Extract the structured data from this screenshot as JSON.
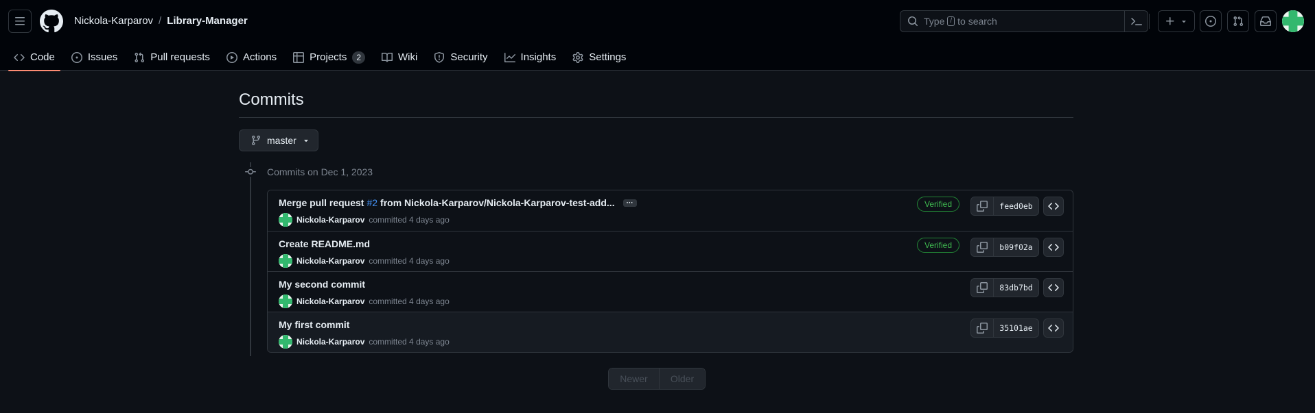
{
  "repo": {
    "owner": "Nickola-Karparov",
    "separator": "/",
    "name": "Library-Manager"
  },
  "search": {
    "placeholder_before": "Type",
    "slash": "/",
    "placeholder_after": "to search"
  },
  "header_icons": [
    "hamburger-icon",
    "github-logo",
    "command-palette-icon",
    "plus-icon",
    "issue-opened-icon",
    "pull-request-icon",
    "inbox-icon"
  ],
  "tabs": [
    {
      "label": "Code",
      "icon": "code-icon",
      "active": true
    },
    {
      "label": "Issues",
      "icon": "issue-icon"
    },
    {
      "label": "Pull requests",
      "icon": "pull-request-icon"
    },
    {
      "label": "Actions",
      "icon": "play-icon"
    },
    {
      "label": "Projects",
      "icon": "table-icon",
      "counter": "2"
    },
    {
      "label": "Wiki",
      "icon": "book-icon"
    },
    {
      "label": "Security",
      "icon": "shield-icon"
    },
    {
      "label": "Insights",
      "icon": "graph-icon"
    },
    {
      "label": "Settings",
      "icon": "gear-icon"
    }
  ],
  "page": {
    "title": "Commits",
    "branch": "master"
  },
  "commit_group": {
    "date_label": "Commits on Dec 1, 2023"
  },
  "commits": [
    {
      "message_pre": "Merge pull request",
      "pr": "#2",
      "message_post": "from Nickola-Karparov/Nickola-Karparov-test-add...",
      "expander": "···",
      "author": "Nickola-Karparov",
      "meta": "committed 4 days ago",
      "verified": "Verified",
      "sha": "feed0eb"
    },
    {
      "message_pre": "Create README.md",
      "author": "Nickola-Karparov",
      "meta": "committed 4 days ago",
      "verified": "Verified",
      "sha": "b09f02a"
    },
    {
      "message_pre": "My second commit",
      "author": "Nickola-Karparov",
      "meta": "committed 4 days ago",
      "sha": "83db7bd"
    },
    {
      "message_pre": "My first commit",
      "author": "Nickola-Karparov",
      "meta": "committed 4 days ago",
      "sha": "35101ae"
    }
  ],
  "pagination": {
    "newer": "Newer",
    "older": "Older"
  },
  "colors": {
    "accent_tab": "#fd8c73",
    "verified": "#3fb950",
    "link": "#4493f8"
  }
}
